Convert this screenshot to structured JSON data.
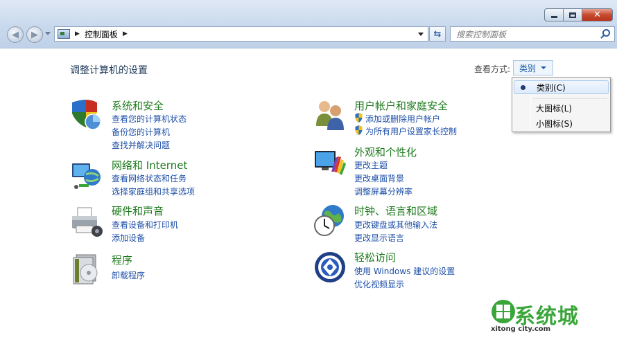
{
  "nav": {
    "breadcrumb": "控制面板",
    "search_placeholder": "搜索控制面板"
  },
  "content": {
    "title": "调整计算机的设置",
    "view_by_label": "查看方式:",
    "view_by_value": "类别"
  },
  "view_menu": {
    "items": [
      "类别(C)",
      "大图标(L)",
      "小图标(S)"
    ],
    "selected_index": 0
  },
  "categories": [
    {
      "title": "系统和安全",
      "links": [
        "查看您的计算机状态",
        "备份您的计算机",
        "查找并解决问题"
      ],
      "icon": "shield-icon"
    },
    {
      "title": "网络和 Internet",
      "links": [
        "查看网络状态和任务",
        "选择家庭组和共享选项"
      ],
      "icon": "network-icon"
    },
    {
      "title": "硬件和声音",
      "links": [
        "查看设备和打印机",
        "添加设备"
      ],
      "icon": "printer-icon"
    },
    {
      "title": "程序",
      "links": [
        "卸载程序"
      ],
      "icon": "programs-icon"
    },
    {
      "title": "用户帐户和家庭安全",
      "links": [
        "添加或删除用户帐户",
        "为所有用户设置家长控制"
      ],
      "icon": "users-icon"
    },
    {
      "title": "外观和个性化",
      "links": [
        "更改主题",
        "更改桌面背景",
        "调整屏幕分辨率"
      ],
      "icon": "appearance-icon"
    },
    {
      "title": "时钟、语言和区域",
      "links": [
        "更改键盘或其他输入法",
        "更改显示语言"
      ],
      "icon": "clock-globe-icon"
    },
    {
      "title": "轻松访问",
      "links": [
        "使用 Windows 建议的设置",
        "优化视频显示"
      ],
      "icon": "ease-of-access-icon"
    }
  ],
  "watermark": {
    "text": "系统城",
    "sub": "xitong city.com"
  },
  "colors": {
    "title_green": "#1e7a1e",
    "link_blue": "#1e4fa8",
    "heading_blue": "#1e395b"
  }
}
